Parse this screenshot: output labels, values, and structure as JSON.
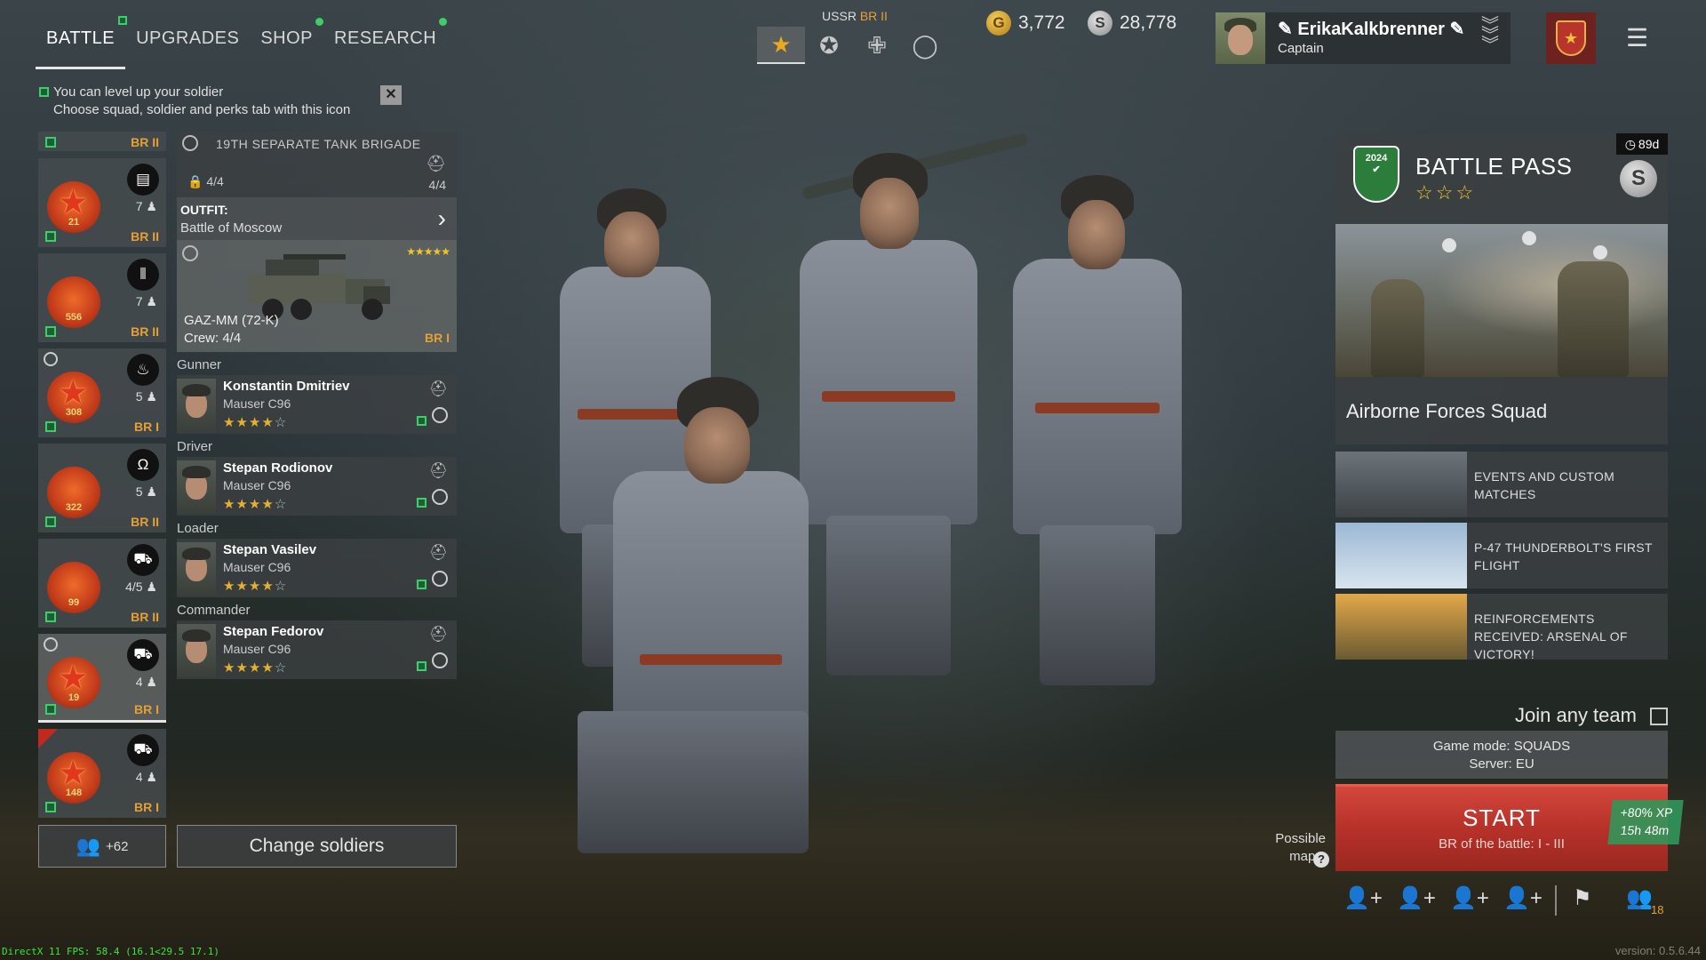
{
  "nav": {
    "tabs": [
      {
        "label": "BATTLE",
        "active": true
      },
      {
        "label": "UPGRADES"
      },
      {
        "label": "SHOP"
      },
      {
        "label": "RESEARCH"
      }
    ]
  },
  "hint": {
    "line1": "You can level up your soldier",
    "line2": "Choose squad, soldier and perks tab with this icon",
    "close": "✕"
  },
  "nation": {
    "name": "USSR",
    "br": "BR II",
    "icons": [
      "star-icon",
      "medal-icon",
      "cross-icon",
      "circle-icon"
    ]
  },
  "currency": {
    "gold": "3,772",
    "silver": "28,778",
    "gold_symbol": "G",
    "silver_symbol": "S"
  },
  "profile": {
    "name": "ErikaKalkbrenner",
    "rank": "Captain"
  },
  "squads": [
    {
      "emblem": "21",
      "count": "7",
      "br": "BR II",
      "type_icon": "document-icon"
    },
    {
      "emblem": "556",
      "count": "7",
      "br": "BR II",
      "type_icon": "ammo-icon"
    },
    {
      "emblem": "308",
      "count": "5",
      "br": "BR I",
      "type_icon": "fire-icon"
    },
    {
      "emblem": "322",
      "count": "5",
      "br": "BR II",
      "type_icon": "headphones-icon"
    },
    {
      "emblem": "99",
      "count": "4/5",
      "br": "BR II",
      "type_icon": "tank-icon"
    },
    {
      "emblem": "19",
      "count": "4",
      "br": "BR I",
      "type_icon": "tank-icon",
      "selected": true
    },
    {
      "emblem": "148",
      "count": "4",
      "br": "BR I",
      "type_icon": "tank-icon"
    }
  ],
  "top_squad_br": "BR II",
  "reserve": {
    "count": "+62"
  },
  "change_soldiers": "Change soldiers",
  "detail": {
    "unit": "19TH SEPARATE TANK BRIGADE",
    "capacity": "4/4",
    "capacity2": "4/4",
    "outfit_label": "OUTFIT:",
    "outfit": "Battle of Moscow",
    "vehicle": {
      "name": "GAZ-MM (72-K)",
      "crew": "Crew: 4/4",
      "br": "BR I",
      "stars": "★★★★★"
    },
    "crew": [
      {
        "role": "Gunner",
        "name": "Konstantin Dmitriev",
        "weapon": "Mauser C96",
        "rating": 4
      },
      {
        "role": "Driver",
        "name": "Stepan Rodionov",
        "weapon": "Mauser C96",
        "rating": 4
      },
      {
        "role": "Loader",
        "name": "Stepan Vasilev",
        "weapon": "Mauser C96",
        "rating": 4
      },
      {
        "role": "Commander",
        "name": "Stepan Fedorov",
        "weapon": "Mauser C96",
        "rating": 4
      }
    ]
  },
  "battle_pass": {
    "title": "BATTLE PASS",
    "year": "2024",
    "timer": "89d",
    "stars": "☆☆☆",
    "squad": "Airborne Forces Squad"
  },
  "events": [
    {
      "title": "EVENTS AND CUSTOM MATCHES"
    },
    {
      "title": "P-47 THUNDERBOLT'S FIRST FLIGHT"
    },
    {
      "title": "REINFORCEMENTS RECEIVED: ARSENAL OF VICTORY!"
    }
  ],
  "join": {
    "label": "Join any team"
  },
  "mode": {
    "line1": "Game mode: SQUADS",
    "line2": "Server: EU"
  },
  "start": {
    "label": "START",
    "sub": "BR of the battle: I - III"
  },
  "bonus": {
    "xp": "+80% XP",
    "time": "15h 48m"
  },
  "maps": {
    "label": "Possible maps:",
    "q": "?"
  },
  "bottom": {
    "squad_count": "18"
  },
  "debug": {
    "fps": "DirectX 11 FPS: 58.4 (16.1<29.5 17.1)",
    "version": "version: 0.5.6.44"
  },
  "colors": {
    "accent_orange": "#e5a033",
    "start_red": "#b73129",
    "level_green": "#3fcc6a"
  }
}
